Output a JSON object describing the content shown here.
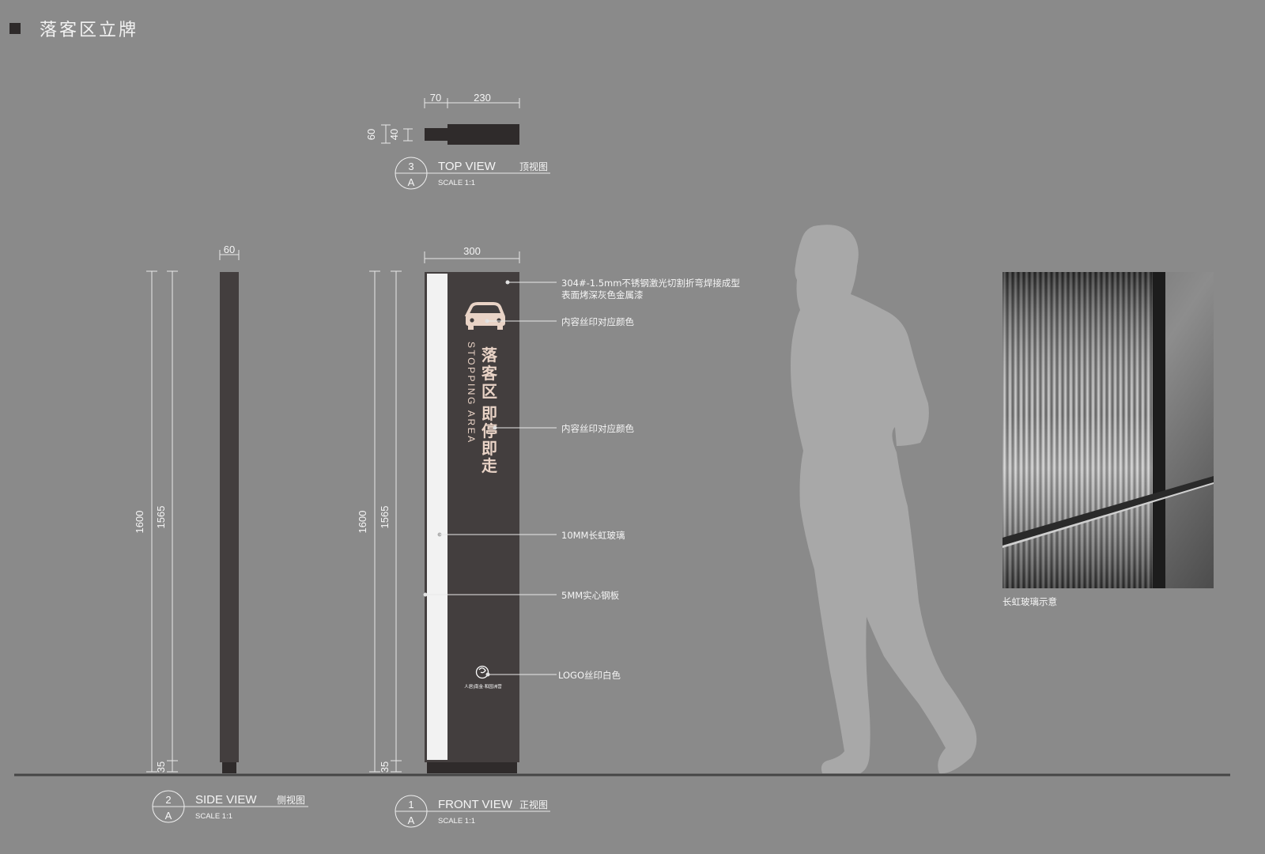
{
  "title": "落客区立牌",
  "top_view": {
    "number": "3",
    "sheet": "A",
    "label": "TOP VIEW",
    "label_cn": "顶视图",
    "scale": "SCALE 1:1",
    "dims": {
      "a": "70",
      "b": "230",
      "c": "60",
      "d": "40"
    }
  },
  "side_view": {
    "number": "2",
    "sheet": "A",
    "label": "SIDE VIEW",
    "label_cn": "侧视图",
    "scale": "SCALE 1:1",
    "dims": {
      "width": "60",
      "total": "1600",
      "body": "1565",
      "base": "35"
    }
  },
  "front_view": {
    "number": "1",
    "sheet": "A",
    "label": "FRONT VIEW",
    "label_cn": "正视图",
    "scale": "SCALE 1:1",
    "dims": {
      "width": "300",
      "total": "1600",
      "body": "1565",
      "base": "35"
    }
  },
  "sign": {
    "title_cn_1": "落客区",
    "title_cn_2": "即停即走",
    "title_en": "STOPPING AREA",
    "logo_text": "人居|南金·和园洲营",
    "car_icon": "car-icon",
    "logo_icon": "swirl-logo-icon"
  },
  "annotations": {
    "material_1": "304#-1.5mm不锈钢激光切割折弯焊接成型",
    "material_2": "表面烤深灰色金属漆",
    "icon_print": "内容丝印对应颜色",
    "text_print": "内容丝印对应颜色",
    "glass": "10MM长虹玻璃",
    "plate": "5MM实心钢板",
    "logo": "LOGO丝印白色"
  },
  "photo_caption": "长虹玻璃示意",
  "colors": {
    "background": "#8a8a8a",
    "sign_body": "#433e3e",
    "glass_strip": "#f2f2f2",
    "accent_text": "#e9d3c6",
    "silhouette": "#a8a8a8"
  }
}
